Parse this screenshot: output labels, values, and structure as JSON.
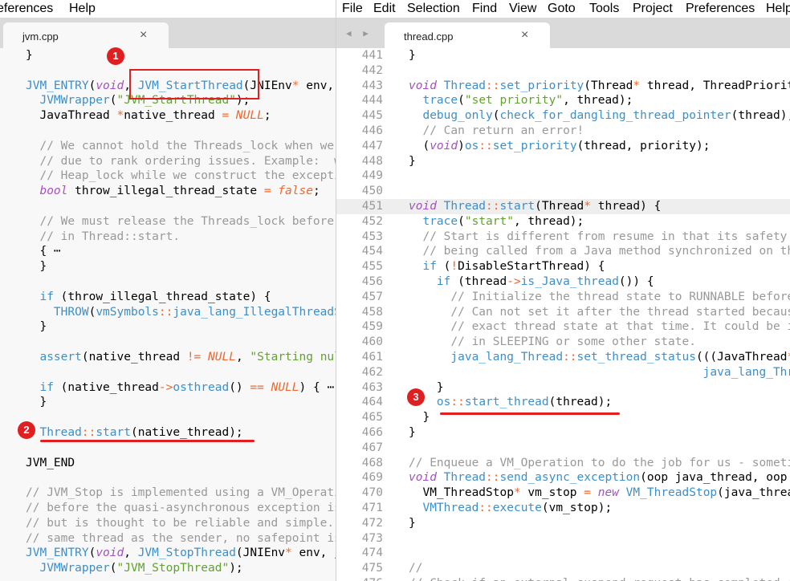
{
  "menus": {
    "left": [
      "eferences",
      "Help"
    ],
    "right": [
      "File",
      "Edit",
      "Selection",
      "Find",
      "View",
      "Goto",
      "Tools",
      "Project",
      "Preferences",
      "Help"
    ]
  },
  "tabs": {
    "left": {
      "label": "jvm.cpp",
      "close": "×"
    },
    "right": {
      "label": "thread.cpp",
      "close": "×"
    }
  },
  "markers": [
    "1",
    "2",
    "3"
  ],
  "left_code": [
    "}",
    "",
    "JVM_ENTRY(void, JVM_StartThread(JNIEnv* env, jobject jthread))",
    "  JVMWrapper(\"JVM_StartThread\");",
    "  JavaThread *native_thread = NULL;",
    "",
    "  // We cannot hold the Threads_lock when we throw an exception,",
    "  // due to rank ordering issues. Example:  we might need to grab the",
    "  // Heap_lock while we construct the exception.",
    "  bool throw_illegal_thread_state = false;",
    "",
    "  // We must release the Threads_lock before we can post a jvmti event",
    "  // in Thread::start.",
    "  { ⋯",
    "  }",
    "",
    "  if (throw_illegal_thread_state) {",
    "    THROW(vmSymbols::java_lang_IllegalThreadStateException());",
    "  }",
    "",
    "  assert(native_thread != NULL, \"Starting null thread?\");",
    "",
    "  if (native_thread->osthread() == NULL) { ⋯",
    "  }",
    "",
    "  Thread::start(native_thread);",
    "",
    "JVM_END",
    "",
    "// JVM_Stop is implemented using a VM_Operation, so threads are forced to safepoints",
    "// before the quasi-asynchronous exception is delivered. This is a little obtrusive,",
    "// but is thought to be reliable and simple. In the case, where the receiver is the",
    "// same thread as the sender, no safepoint is needed.",
    "JVM_ENTRY(void, JVM_StopThread(JNIEnv* env, jobject jthread, jobject throwable))",
    "  JVMWrapper(\"JVM_StopThread\");"
  ],
  "right_code": [
    {
      "n": "441",
      "t": "}"
    },
    {
      "n": "442",
      "t": ""
    },
    {
      "n": "443",
      "t": "void Thread::set_priority(Thread* thread, ThreadPriority priority) {"
    },
    {
      "n": "444",
      "t": "  trace(\"set priority\", thread);"
    },
    {
      "n": "445",
      "t": "  debug_only(check_for_dangling_thread_pointer(thread);)"
    },
    {
      "n": "446",
      "t": "  // Can return an error!"
    },
    {
      "n": "447",
      "t": "  (void)os::set_priority(thread, priority);"
    },
    {
      "n": "448",
      "t": "}"
    },
    {
      "n": "449",
      "t": ""
    },
    {
      "n": "450",
      "t": ""
    },
    {
      "n": "451",
      "t": "void Thread::start(Thread* thread) {"
    },
    {
      "n": "452",
      "t": "  trace(\"start\", thread);"
    },
    {
      "n": "453",
      "t": "  // Start is different from resume in that its safety is guaranteed by context or"
    },
    {
      "n": "454",
      "t": "  // being called from a Java method synchronized on the Thread object."
    },
    {
      "n": "455",
      "t": "  if (!DisableStartThread) {"
    },
    {
      "n": "456",
      "t": "    if (thread->is_Java_thread()) {"
    },
    {
      "n": "457",
      "t": "      // Initialize the thread state to RUNNABLE before starting this thread."
    },
    {
      "n": "458",
      "t": "      // Can not set it after the thread started because we do not know the"
    },
    {
      "n": "459",
      "t": "      // exact thread state at that time. It could be in MONITOR_WAIT or"
    },
    {
      "n": "460",
      "t": "      // in SLEEPING or some other state."
    },
    {
      "n": "461",
      "t": "      java_lang_Thread::set_thread_status(((JavaThread*)thread)->threadObj(),"
    },
    {
      "n": "462",
      "t": "                                          java_lang_Thread::RUNNABLE);"
    },
    {
      "n": "463",
      "t": "    }"
    },
    {
      "n": "464",
      "t": "    os::start_thread(thread);"
    },
    {
      "n": "465",
      "t": "  }"
    },
    {
      "n": "466",
      "t": "}"
    },
    {
      "n": "467",
      "t": ""
    },
    {
      "n": "468",
      "t": "// Enqueue a VM_Operation to do the job for us - sometime later"
    },
    {
      "n": "469",
      "t": "void Thread::send_async_exception(oop java_thread, oop java_throwable) {"
    },
    {
      "n": "470",
      "t": "  VM_ThreadStop* vm_stop = new VM_ThreadStop(java_thread, java_throwable);"
    },
    {
      "n": "471",
      "t": "  VMThread::execute(vm_stop);"
    },
    {
      "n": "472",
      "t": "}"
    },
    {
      "n": "473",
      "t": ""
    },
    {
      "n": "474",
      "t": ""
    },
    {
      "n": "475",
      "t": "//"
    },
    {
      "n": "476",
      "t": "// Check if an external suspend request has completed (or has been"
    }
  ],
  "colors": {
    "marker": "#e02020",
    "keyword": "#a74ec4",
    "function": "#3e8fc8",
    "string": "#62a230",
    "comment": "#999999",
    "null": "#f1672d"
  }
}
